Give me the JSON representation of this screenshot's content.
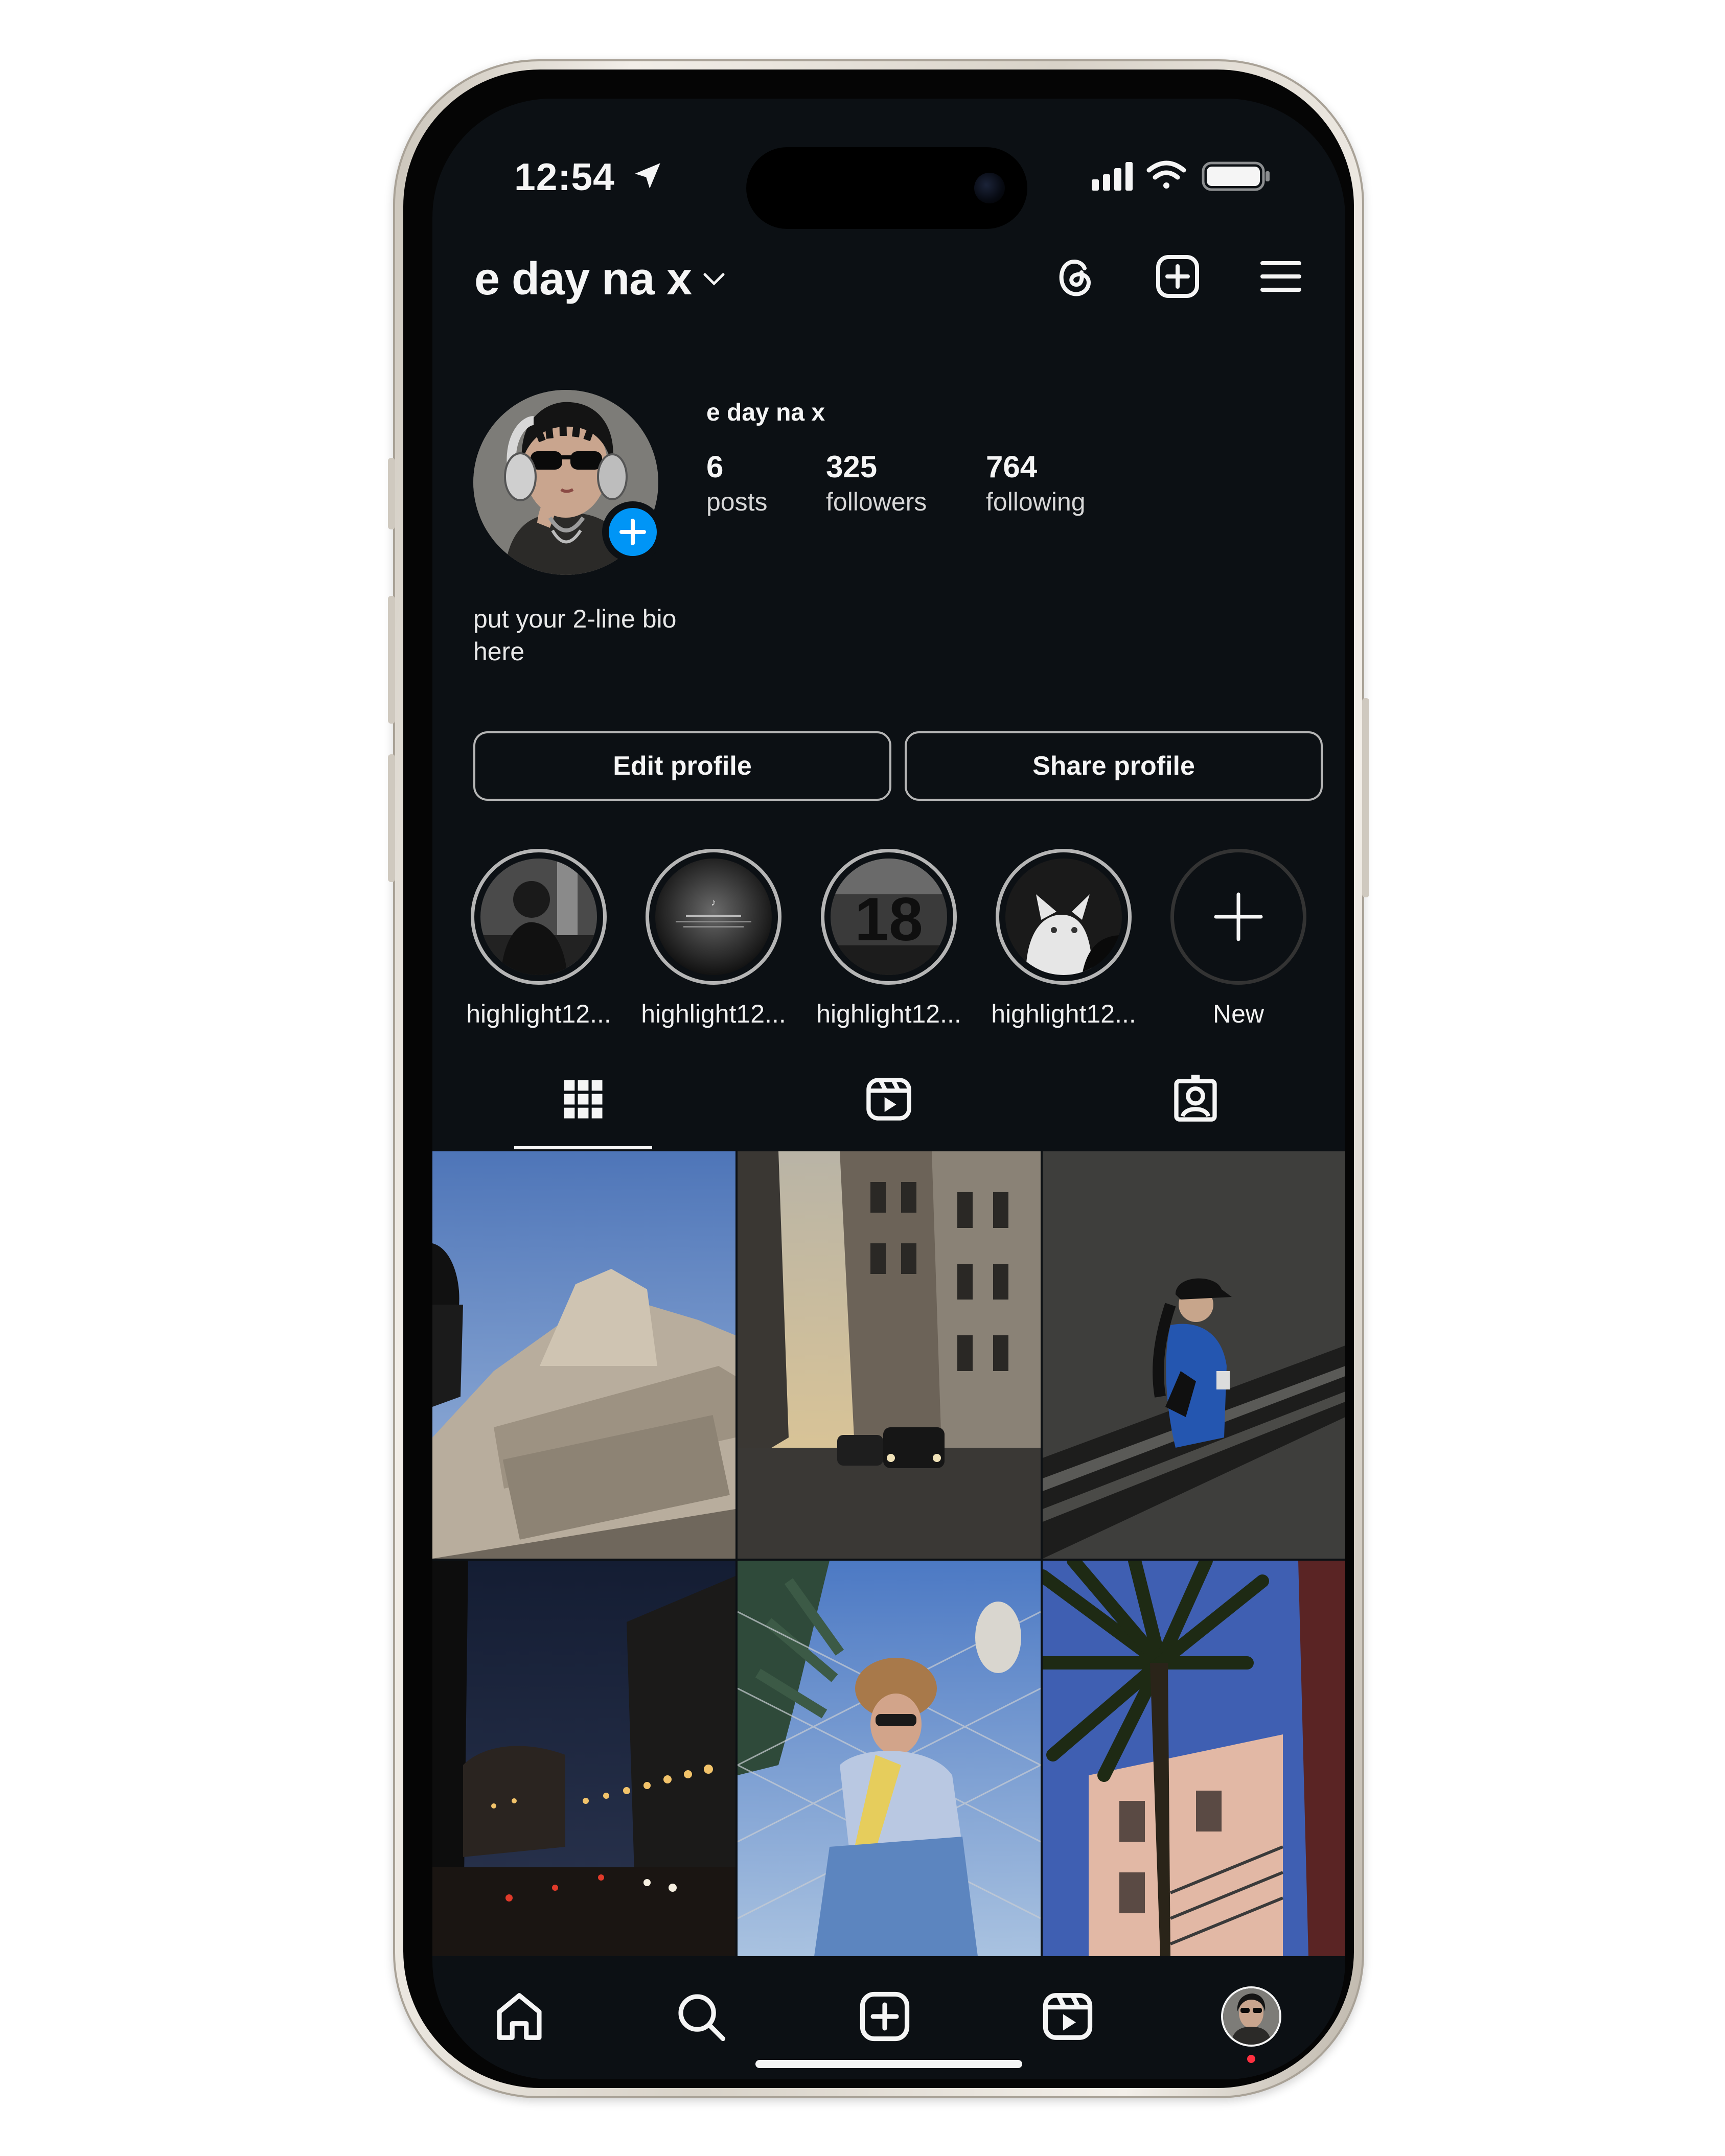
{
  "status_bar": {
    "time": "12:54"
  },
  "header": {
    "username": "e day na x"
  },
  "profile": {
    "display_name": "e day na x",
    "stats": [
      {
        "value": "6",
        "label": "posts"
      },
      {
        "value": "325",
        "label": "followers"
      },
      {
        "value": "764",
        "label": "following"
      }
    ],
    "bio_line1": "put your 2-line bio",
    "bio_line2": "here"
  },
  "buttons": {
    "edit": "Edit profile",
    "share": "Share profile"
  },
  "highlights": [
    {
      "label": "highlight12..."
    },
    {
      "label": "highlight12..."
    },
    {
      "label": "highlight12..."
    },
    {
      "label": "highlight12..."
    },
    {
      "label": "New"
    }
  ],
  "highlight_2_thumb_text": "♪",
  "highlight_3_thumb_text": "18",
  "tabs": [
    "grid-icon",
    "reels-icon",
    "tagged-icon"
  ],
  "bottom_nav": [
    "home-icon",
    "search-icon",
    "create-icon",
    "reels-icon",
    "profile-avatar"
  ],
  "colors": {
    "background": "#0c1014",
    "text": "#f5f5f5",
    "accent": "#0095f6",
    "notification_dot": "#ff3040"
  }
}
